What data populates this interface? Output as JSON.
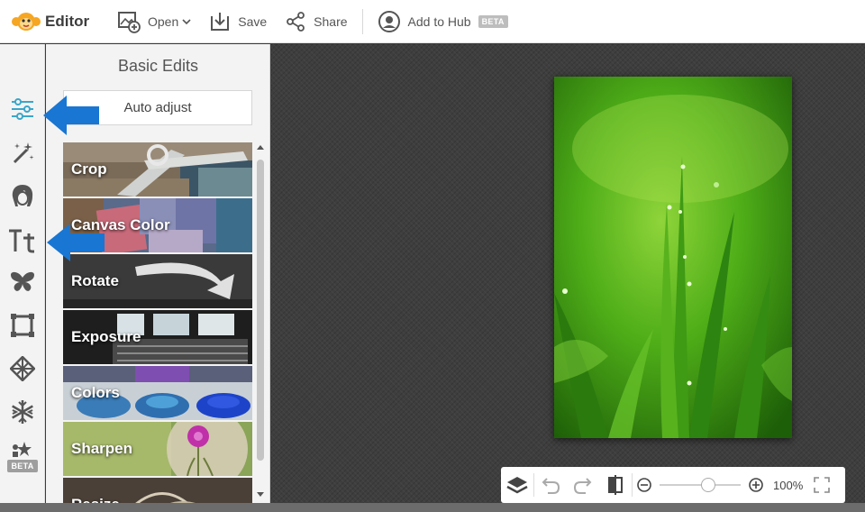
{
  "app": {
    "name": "Editor"
  },
  "toolbar": {
    "open_label": "Open",
    "save_label": "Save",
    "share_label": "Share",
    "hub_label": "Add to Hub",
    "hub_badge": "BETA"
  },
  "rail": {
    "items": [
      {
        "name": "basic-edits",
        "icon": "sliders-icon"
      },
      {
        "name": "effects",
        "icon": "magic-wand-icon"
      },
      {
        "name": "touch-up",
        "icon": "face-icon"
      },
      {
        "name": "text",
        "icon": "text-icon"
      },
      {
        "name": "overlays",
        "icon": "butterfly-icon"
      },
      {
        "name": "frames",
        "icon": "frame-icon"
      },
      {
        "name": "textures",
        "icon": "texture-icon"
      },
      {
        "name": "seasonal",
        "icon": "snowflake-icon"
      },
      {
        "name": "design",
        "icon": "design-icon",
        "badge": "BETA"
      }
    ]
  },
  "panel": {
    "title": "Basic Edits",
    "auto_adjust": "Auto adjust",
    "items": [
      {
        "label": "Crop"
      },
      {
        "label": "Canvas Color"
      },
      {
        "label": "Rotate"
      },
      {
        "label": "Exposure"
      },
      {
        "label": "Colors"
      },
      {
        "label": "Sharpen"
      },
      {
        "label": "Resize"
      }
    ]
  },
  "zoom": {
    "value": "100%",
    "level": 0.6
  },
  "colors": {
    "accent": "#1976d2",
    "brand": "#f5a623",
    "canvas": "#3e3e3e"
  }
}
